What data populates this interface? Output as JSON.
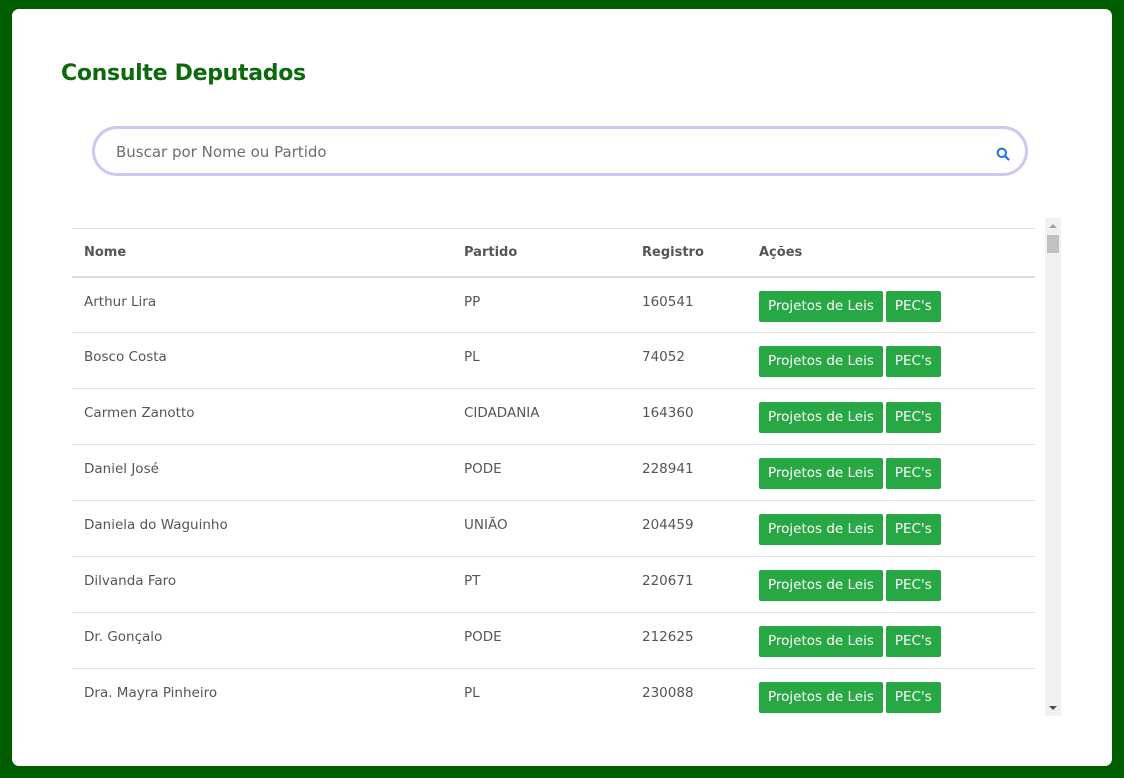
{
  "page": {
    "title": "Consulte Deputados",
    "colors": {
      "frame": "#005e00",
      "title": "#0b6a0b",
      "button": "#28a745",
      "search_border": "#c9c9f3"
    }
  },
  "search": {
    "placeholder": "Buscar por Nome ou Partido",
    "value": "",
    "icon": "search-icon"
  },
  "table": {
    "headers": {
      "nome": "Nome",
      "partido": "Partido",
      "registro": "Registro",
      "acoes": "Ações"
    },
    "rows": [
      {
        "nome": "Arthur Lira",
        "partido": "PP",
        "registro": "160541"
      },
      {
        "nome": "Bosco Costa",
        "partido": "PL",
        "registro": "74052"
      },
      {
        "nome": "Carmen Zanotto",
        "partido": "CIDADANIA",
        "registro": "164360"
      },
      {
        "nome": "Daniel José",
        "partido": "PODE",
        "registro": "228941"
      },
      {
        "nome": "Daniela do Waguinho",
        "partido": "UNIÃO",
        "registro": "204459"
      },
      {
        "nome": "Dilvanda Faro",
        "partido": "PT",
        "registro": "220671"
      },
      {
        "nome": "Dr. Gonçalo",
        "partido": "PODE",
        "registro": "212625"
      },
      {
        "nome": "Dra. Mayra Pinheiro",
        "partido": "PL",
        "registro": "230088"
      }
    ],
    "action_labels": {
      "projetos": "Projetos de Leis",
      "pecs": "PEC's"
    }
  }
}
